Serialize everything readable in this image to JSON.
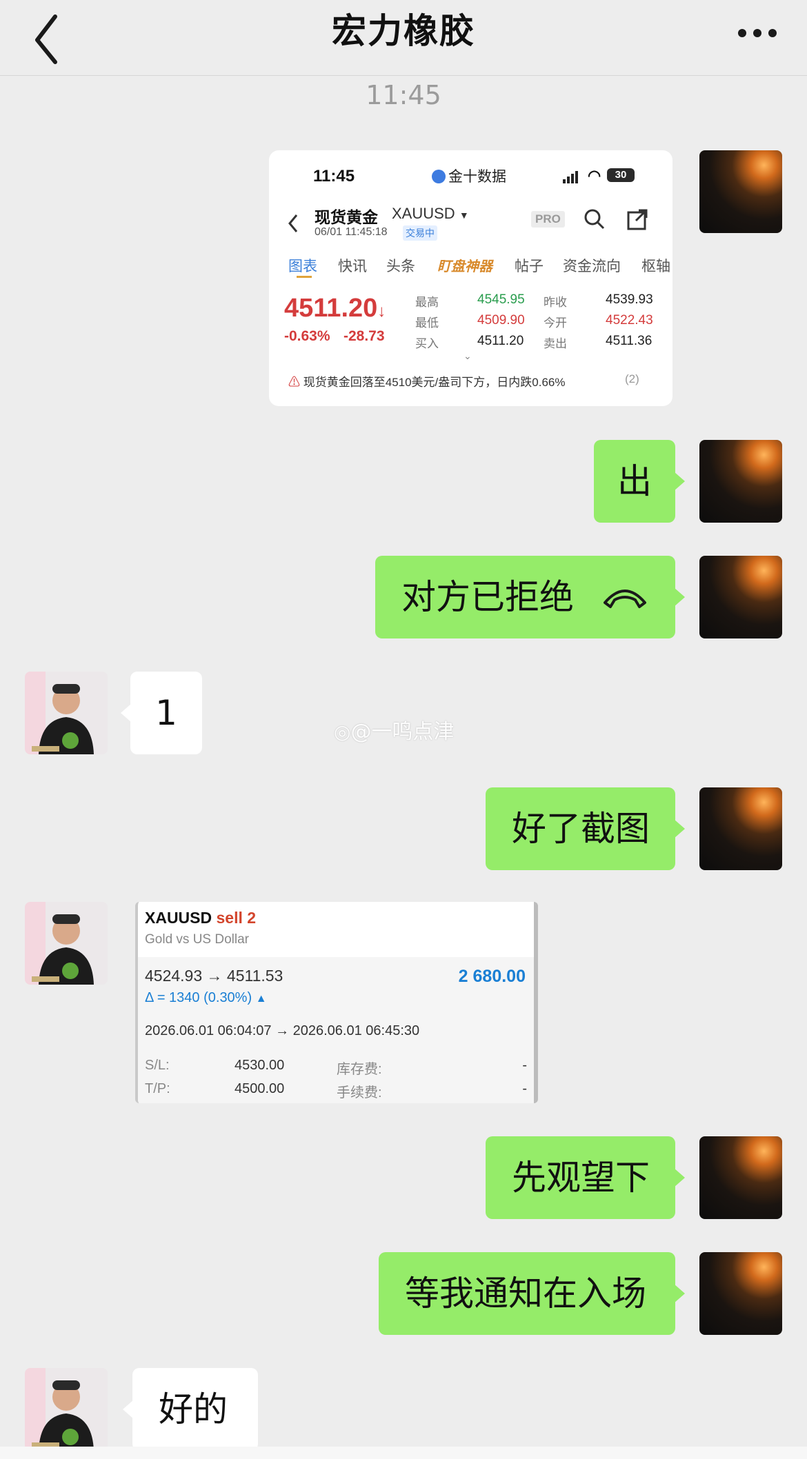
{
  "header": {
    "title": "宏力橡胶"
  },
  "timestamp": "11:45",
  "gold_screenshot": {
    "status_time": "11:45",
    "app_name": "金十数据",
    "battery": "30",
    "instrument_name": "现货黄金",
    "symbol": "XAUUSD",
    "datetime": "06/01 11:45:18",
    "trading_status": "交易中",
    "pro_badge": "PRO",
    "tabs": [
      "图表",
      "快讯",
      "头条",
      "盯盘神器",
      "帖子",
      "资金流向",
      "枢轴"
    ],
    "price": "4511.20",
    "change_pct": "-0.63%",
    "change_abs": "-28.73",
    "stats": [
      {
        "label": "最高",
        "value": "4545.95",
        "color": "#2a9d4e"
      },
      {
        "label": "昨收",
        "value": "4539.93",
        "color": "#222222"
      },
      {
        "label": "最低",
        "value": "4509.90",
        "color": "#d43c3c"
      },
      {
        "label": "今开",
        "value": "4522.43",
        "color": "#d43c3c"
      },
      {
        "label": "买入",
        "value": "4511.20",
        "color": "#222222"
      },
      {
        "label": "卖出",
        "value": "4511.36",
        "color": "#222222"
      }
    ],
    "news": "现货黄金回落至4510美元/盎司下方，日内跌0.66%",
    "news_count": "(2)"
  },
  "messages": {
    "m1": "出",
    "m2": "对方已拒绝",
    "m3": "1",
    "m4": "好了截图",
    "m5": "先观望下",
    "m6": "等我通知在入场",
    "m7": "好的"
  },
  "watermark": "@一鸣点津",
  "trade": {
    "symbol": "XAUUSD",
    "side": "sell 2",
    "description": "Gold vs US Dollar",
    "prices": "4524.93 → 4511.53",
    "profit": "2 680.00",
    "delta": "Δ = 1340 (0.30%)",
    "times": "2026.06.01 06:04:07 → 2026.06.01 06:45:30",
    "sl_label": "S/L:",
    "sl_value": "4530.00",
    "tp_label": "T/P:",
    "tp_value": "4500.00",
    "swap_label": "库存费:",
    "swap_value": "-",
    "fee_label": "手续费:",
    "fee_value": "-"
  },
  "colors": {
    "bubble_me": "#95ec69",
    "bubble_other": "#ffffff",
    "background": "#ededed",
    "price_red": "#d43c3c",
    "profit_blue": "#1a7fd4"
  }
}
